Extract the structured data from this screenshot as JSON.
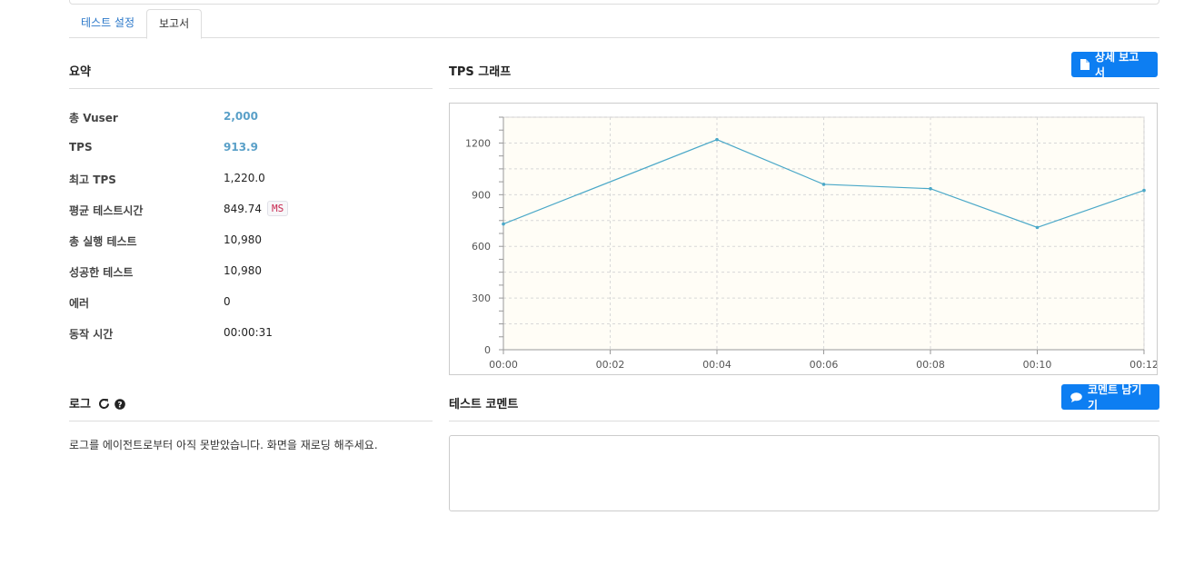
{
  "tabs": [
    {
      "label": "테스트 설정"
    },
    {
      "label": "보고서"
    }
  ],
  "summary": {
    "title": "요약",
    "rows": [
      {
        "label": "총 Vuser",
        "value": "2,000"
      },
      {
        "label": "TPS",
        "value": "913.9"
      },
      {
        "label": "최고 TPS",
        "value": "1,220.0"
      },
      {
        "label": "평균 테스트시간",
        "value": "849.74",
        "unit": "MS"
      },
      {
        "label": "총 실행 테스트",
        "value": "10,980"
      },
      {
        "label": "성공한 테스트",
        "value": "10,980"
      },
      {
        "label": "에러",
        "value": "0"
      },
      {
        "label": "동작 시간",
        "value": "00:00:31"
      }
    ]
  },
  "tps_graph": {
    "title": "TPS 그래프",
    "detail_button": "상세 보고서"
  },
  "chart_data": {
    "type": "line",
    "x": [
      "00:00",
      "00:04",
      "00:06",
      "00:08",
      "00:10",
      "00:12"
    ],
    "x_seconds": [
      0,
      4,
      6,
      8,
      10,
      12
    ],
    "y": [
      730,
      1220,
      960,
      935,
      710,
      925
    ],
    "xticks": [
      "00:00",
      "00:02",
      "00:04",
      "00:06",
      "00:08",
      "00:10",
      "00:12"
    ],
    "yticks": [
      "0",
      "300",
      "600",
      "900",
      "1200"
    ],
    "xlim": [
      0,
      12
    ],
    "ylim": [
      0,
      1350
    ],
    "grid": true,
    "line_color": "#4aa8c8",
    "plot_bg": "#fffdf6"
  },
  "log": {
    "title": "로그",
    "message": "로그를 에이전트로부터 아직 못받았습니다. 화면을 재로딩 해주세요."
  },
  "comment": {
    "title": "테스트 코멘트",
    "button": "코멘트 남기기",
    "value": ""
  },
  "icons": {
    "refresh": "refresh-icon",
    "help": "question-circle-icon",
    "file": "file-icon",
    "comment": "comment-icon"
  },
  "colors": {
    "primary_button": "#0d7ef2",
    "tab_link": "#2a77c9",
    "highlight_value": "#5aa0c8"
  }
}
